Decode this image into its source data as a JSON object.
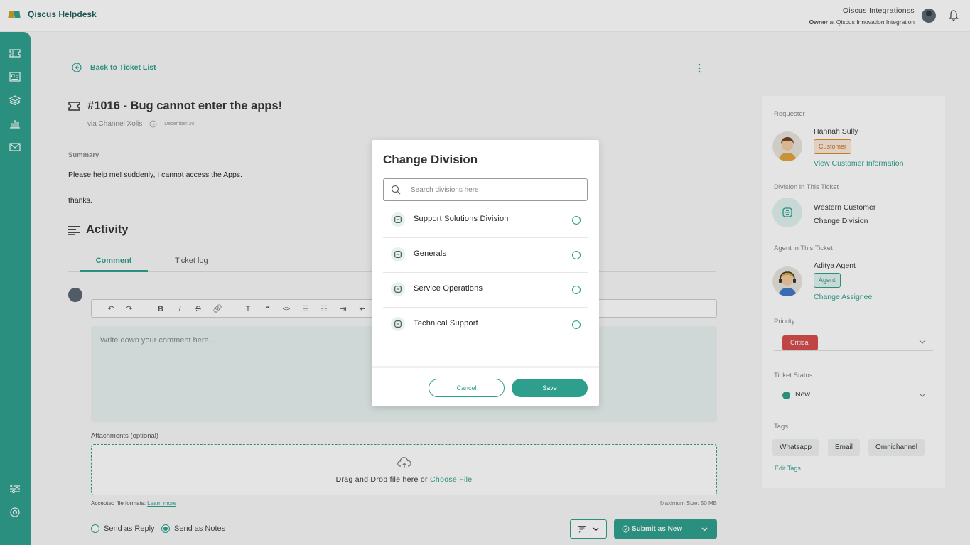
{
  "app": {
    "name": "Qiscus Helpdesk"
  },
  "user": {
    "name": "Qiscus Integrationss",
    "role": "Owner",
    "org_text": "at Qiscus Innovation Integration"
  },
  "ticket": {
    "back_label": "Back to Ticket List",
    "title": "#1016 - Bug cannot enter the apps!",
    "channel": "via Channel Xolis",
    "date": "December 20",
    "summary_label": "Summary",
    "summary_text": "Please help me! suddenly, I cannot access the Apps.",
    "summary_thanks": "thanks."
  },
  "activity": {
    "title": "Activity",
    "tabs": [
      "Comment",
      "Ticket log"
    ],
    "editor_placeholder": "Write down your comment here...",
    "attachments_label": "Attachments (optional)",
    "drop_text": "Drag and Drop file here or ",
    "choose_file": "Choose File",
    "formats_text": "Accepted file formats: ",
    "learn_more": "Learn more",
    "max_size": "Maximum Size: 50 MB",
    "send_reply": "Send as Reply",
    "send_notes": "Send as Notes",
    "selected_send": "notes",
    "submit_label": "Submit as New"
  },
  "sidebar_right": {
    "requester_label": "Requester",
    "requester_name": "Hannah Sully",
    "requester_badge": "Customer",
    "view_customer": "View Customer Information",
    "division_label": "Division in This Ticket",
    "division_name": "Western Customer",
    "change_division": "Change Division",
    "agent_label": "Agent in This Ticket",
    "agent_name": "Aditya Agent",
    "agent_badge": "Agent",
    "change_assignee": "Change Assignee",
    "priority_label": "Priority",
    "priority_value": "Critical",
    "status_label": "Ticket Status",
    "status_value": "New",
    "tags_label": "Tags",
    "tags": [
      "Whatsapp",
      "Email",
      "Omnichannel"
    ],
    "edit_tags": "Edit Tags"
  },
  "modal": {
    "title": "Change Division",
    "search_placeholder": "Search divisions here",
    "divisions": [
      "Support Solutions Division",
      "Generals",
      "Service Operations",
      "Technical Support"
    ],
    "cancel_label": "Cancel",
    "save_label": "Save"
  },
  "colors": {
    "accent": "#2d9f8c",
    "critical": "#d64c4c",
    "customer_badge": "#d78a33"
  }
}
